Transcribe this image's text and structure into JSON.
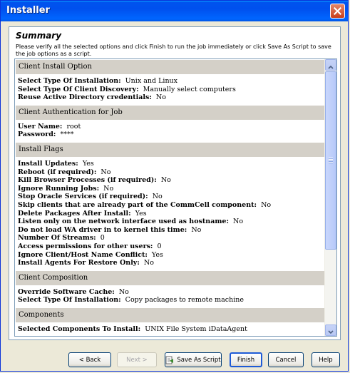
{
  "window": {
    "title": "Installer"
  },
  "summary": {
    "title": "Summary",
    "instructions": "Please verify all the selected options and click Finish to run the job immediately or click Save As Script to save the job options as a script."
  },
  "sections": [
    {
      "header": "Client Install Option",
      "rows": [
        {
          "label": "Select Type Of Installation:",
          "value": "Unix and Linux"
        },
        {
          "label": "Select Type Of Client Discovery:",
          "value": "Manually select computers"
        },
        {
          "label": "Reuse Active Directory credentials:",
          "value": "No"
        }
      ]
    },
    {
      "header": "Client Authentication for Job",
      "rows": [
        {
          "label": "User Name:",
          "value": "root"
        },
        {
          "label": "Password:",
          "value": "****"
        }
      ]
    },
    {
      "header": "Install Flags",
      "rows": [
        {
          "label": "Install Updates:",
          "value": "Yes"
        },
        {
          "label": "Reboot (if required):",
          "value": "No"
        },
        {
          "label": "Kill Browser Processes (if required):",
          "value": "No"
        },
        {
          "label": "Ignore Running Jobs:",
          "value": "No"
        },
        {
          "label": "Stop Oracle Services (if required):",
          "value": "No"
        },
        {
          "label": "Skip clients that are already part of the CommCell component:",
          "value": "No"
        },
        {
          "label": "Delete Packages After Install:",
          "value": "Yes"
        },
        {
          "label": "Listen only on the network interface used as hostname:",
          "value": "No"
        },
        {
          "label": "Do not load WA driver in to kernel this time:",
          "value": "No"
        },
        {
          "label": "Number Of Streams:",
          "value": "0"
        },
        {
          "label": "Access permissions for other users:",
          "value": "0"
        },
        {
          "label": "Ignore Client/Host Name Conflict:",
          "value": "Yes"
        },
        {
          "label": "Install Agents For Restore Only:",
          "value": "No"
        }
      ]
    },
    {
      "header": "Client Composition",
      "rows": [
        {
          "label": "Override Software Cache:",
          "value": "No"
        },
        {
          "label": "Select Type Of Installation:",
          "value": "Copy packages to remote machine"
        }
      ]
    },
    {
      "header": "Components",
      "rows": [
        {
          "label": "Selected Components To Install:",
          "value": "UNIX File System iDataAgent"
        }
      ]
    }
  ],
  "buttons": {
    "back": "< Back",
    "next": "Next >",
    "save_as_script": "Save As Script",
    "finish": "Finish",
    "cancel": "Cancel",
    "help": "Help"
  },
  "icons": {
    "close": "close-icon",
    "save_script": "script-icon"
  }
}
